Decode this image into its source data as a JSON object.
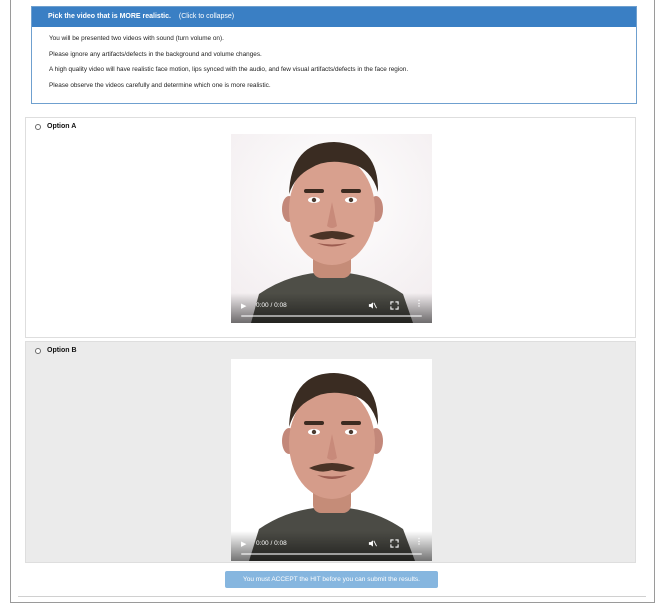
{
  "instructions": {
    "title": "Pick the video that is MORE realistic.",
    "collapse_hint": "(Click to collapse)",
    "lines": [
      "You will be presented two videos with sound (turn volume on).",
      "Please ignore any artifacts/defects in the background and volume changes.",
      "A high quality video will have realistic face motion, lips synced with the audio, and few visual artifacts/defects in the face region.",
      "Please observe the videos carefully and determine which one is more realistic."
    ]
  },
  "options": [
    {
      "label": "Option A",
      "time": "0:00 / 0:08",
      "selected": false,
      "progress": 0
    },
    {
      "label": "Option B",
      "time": "0:00 / 0:08",
      "selected": false,
      "progress": 0
    }
  ],
  "submit": {
    "label": "You must ACCEPT the HIT before you can submit the results.",
    "color": "#86b6df"
  },
  "colors": {
    "header": "#3a7fc4",
    "option_b_bg": "#ebebeb"
  }
}
